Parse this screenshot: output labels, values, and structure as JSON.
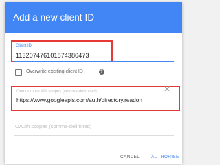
{
  "dialog": {
    "title": "Add a new client ID"
  },
  "client_id": {
    "label": "Client ID",
    "value": "113207476101874380473"
  },
  "overwrite": {
    "label": "Overwrite existing client ID",
    "help_icon": "help-circle-icon",
    "checked": false
  },
  "scope": {
    "label": "One or more API scopes (comma-delimited)",
    "value": "https://www.googleapis.com/auth/directory.readon",
    "close_icon": "close-icon"
  },
  "oauth_scopes": {
    "placeholder": "OAuth scopes (comma-delimited)"
  },
  "actions": {
    "cancel_label": "CANCEL",
    "authorise_label": "AUTHORISE"
  },
  "colors": {
    "header": "#4285f4",
    "highlight": "#e53935",
    "accent": "#4285f4"
  }
}
